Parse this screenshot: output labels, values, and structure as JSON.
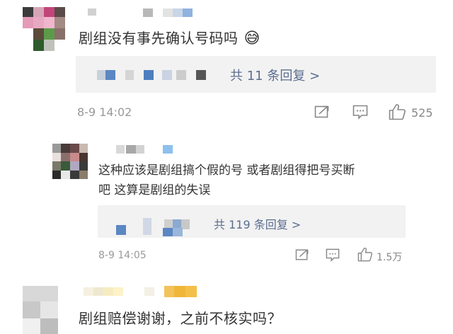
{
  "comments": [
    {
      "text": "剧组没有事先确认号码吗",
      "emoji": "😅",
      "replies_link": "共 11 条回复 >",
      "timestamp": "8-9 14:02",
      "like_count": "525"
    },
    {
      "text_line1": "这种应该是剧组搞个假的号 或者剧组得把号买断",
      "text_line2": "吧 这算是剧组的失误",
      "replies_link": "共 119 条回复 >",
      "timestamp": "8-9 14:05",
      "like_count": "1.5万"
    },
    {
      "text": "剧组赔偿谢谢，之前不核实吗？"
    }
  ],
  "icons": {
    "share": "share-icon",
    "comment": "comment-icon",
    "like": "thumbs-up-icon"
  }
}
